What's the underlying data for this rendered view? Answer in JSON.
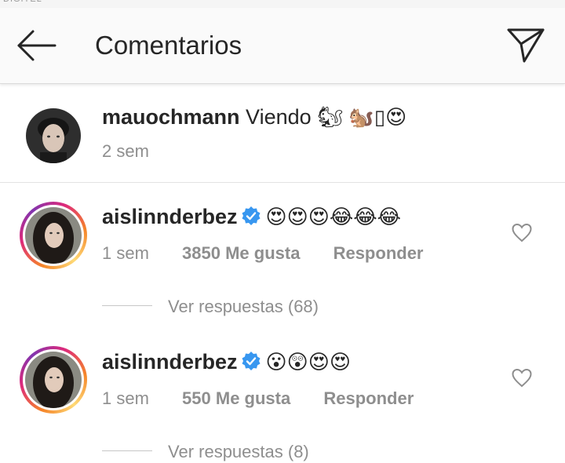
{
  "header": {
    "title": "Comentarios",
    "back_icon": "arrow-left-icon",
    "send_icon": "paper-plane-icon"
  },
  "caption": {
    "username": "mauochmann",
    "text": "Viendo",
    "emojis": "🐿 🐿️▯😍",
    "time": "2 sem"
  },
  "comments": [
    {
      "username": "aislinnderbez",
      "verified": true,
      "emojis": "😍😍😍😂😂😂",
      "time": "1 sem",
      "likes": "3850 Me gusta",
      "reply_label": "Responder",
      "view_replies": "Ver respuestas (68)"
    },
    {
      "username": "aislinnderbez",
      "verified": true,
      "emojis": "😮😲😍😍",
      "time": "1 sem",
      "likes": "550 Me gusta",
      "reply_label": "Responder",
      "view_replies": "Ver respuestas (8)"
    }
  ],
  "colors": {
    "verified_blue": "#3897f0",
    "meta_gray": "#8e8e8e",
    "ring_pink": "#dd2a7b",
    "ring_orange": "#f58529"
  }
}
